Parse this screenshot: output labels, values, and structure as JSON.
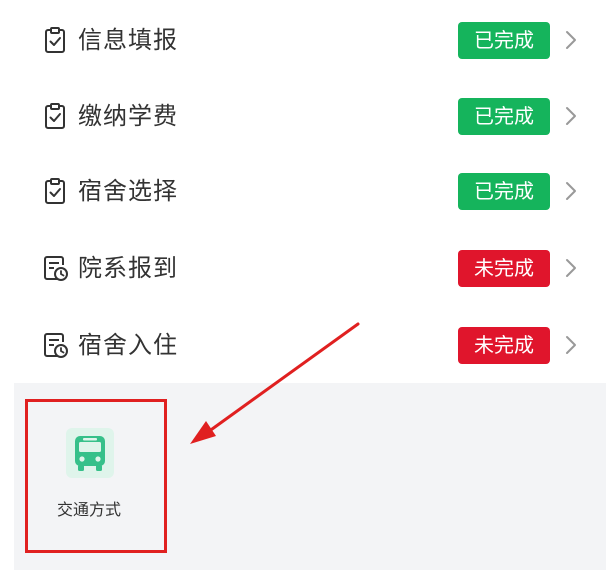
{
  "tasks": [
    {
      "label": "信息填报",
      "status": "已完成",
      "icon": "clipboard-check-icon"
    },
    {
      "label": "缴纳学费",
      "status": "已完成",
      "icon": "clipboard-check-icon"
    },
    {
      "label": "宿舍选择",
      "status": "已完成",
      "icon": "clipboard-check-icon"
    },
    {
      "label": "院系报到",
      "status": "未完成",
      "icon": "document-clock-icon"
    },
    {
      "label": "宿舍入住",
      "status": "未完成",
      "icon": "document-clock-icon"
    }
  ],
  "transport": {
    "label": "交通方式",
    "icon": "bus-icon"
  },
  "colors": {
    "completed": "#15b45c",
    "incomplete": "#e0152c",
    "bus_icon": "#36c08a",
    "annotation": "#e02020"
  }
}
